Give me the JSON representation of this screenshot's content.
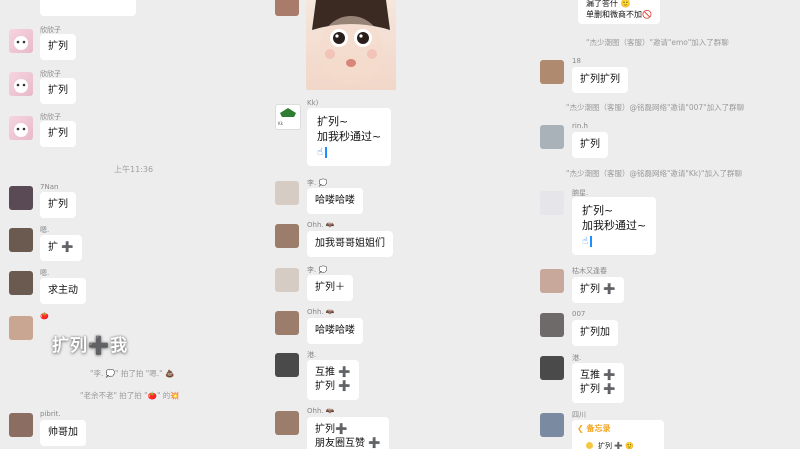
{
  "col1": {
    "top_name": "欣欣子",
    "entries": [
      {
        "name": "欣欣子",
        "text": "扩列",
        "avatar": "cat-avatar"
      },
      {
        "name": "欣欣子",
        "text": "扩列",
        "avatar": "cat-avatar"
      },
      {
        "name": "欣欣子",
        "text": "扩列",
        "avatar": "cat-avatar"
      }
    ],
    "time": "上午11:36",
    "entries2": [
      {
        "name": "7Nan",
        "text": "扩列"
      },
      {
        "name": "嗯.",
        "text": "扩 ➕"
      },
      {
        "name": "嗯.",
        "text": "求主动"
      }
    ],
    "red_name": "🍅",
    "big_text": "扩列➕我",
    "sys1": "\"李. 💭\" 拍了拍 \"嗯.\" 💩",
    "sys2": "\"老余不老\" 拍了拍 \"🍅\" 的💥",
    "last_name": "pibrit.",
    "last_text": "帅哥加"
  },
  "col2": {
    "kk_name": "Kk)",
    "kk_line1": "扩列~",
    "kk_line2": "加我秒通过~",
    "kk_hand": "☝",
    "entries": [
      {
        "name": "李. 💭",
        "text": "哈喽哈喽"
      },
      {
        "name": "Ohh. 🦇",
        "text": "加我哥哥姐姐们"
      },
      {
        "name": "李. 💭",
        "text": "扩列＋"
      },
      {
        "name": "Ohh. 🦇",
        "text": "哈喽哈喽"
      }
    ],
    "gang_name": "港.",
    "gang_line1": "互推 ➕",
    "gang_line2": "扩列 ➕",
    "ohh_name": "Ohh. 🦇",
    "ohh_line1": "扩列➕",
    "ohh_line2": "朋友圈互赞 ➕"
  },
  "col3": {
    "top_line1": "漏了答什 🙂",
    "top_line2": "单删和微商不加🚫",
    "sys_emo": "\"杰少潮图（客服）\"邀请\"emo\"加入了群聊",
    "e18_name": "18",
    "e18_text": "扩列扩列",
    "sys_007": "\"杰少潮图（客服）@铭磊网络\"邀请\"007\"加入了群聊",
    "rinh_name": "rin.h",
    "rinh_text": "扩列",
    "sys_kk": "\"杰少潮图（客服）@铭磊网络\"邀请\"Kk)\"加入了群聊",
    "xing_name": "腕星.",
    "xing_line1": "扩列~",
    "xing_line2": "加我秒通过~",
    "xing_hand": "☝",
    "entries": [
      {
        "name": "枯木又逢春",
        "text": "扩列 ➕"
      },
      {
        "name": "007",
        "text": "扩列加"
      }
    ],
    "gang_name": "港.",
    "gang_line1": "互推 ➕",
    "gang_line2": "扩列 ➕",
    "last_name": "四川",
    "memo_title": "备忘录",
    "memo_text": "扩列 ➕ 🙂"
  },
  "colors": {
    "background": "#ededed",
    "bubble": "#ffffff",
    "link": "#2a7de1",
    "memo": "#f5a623"
  }
}
